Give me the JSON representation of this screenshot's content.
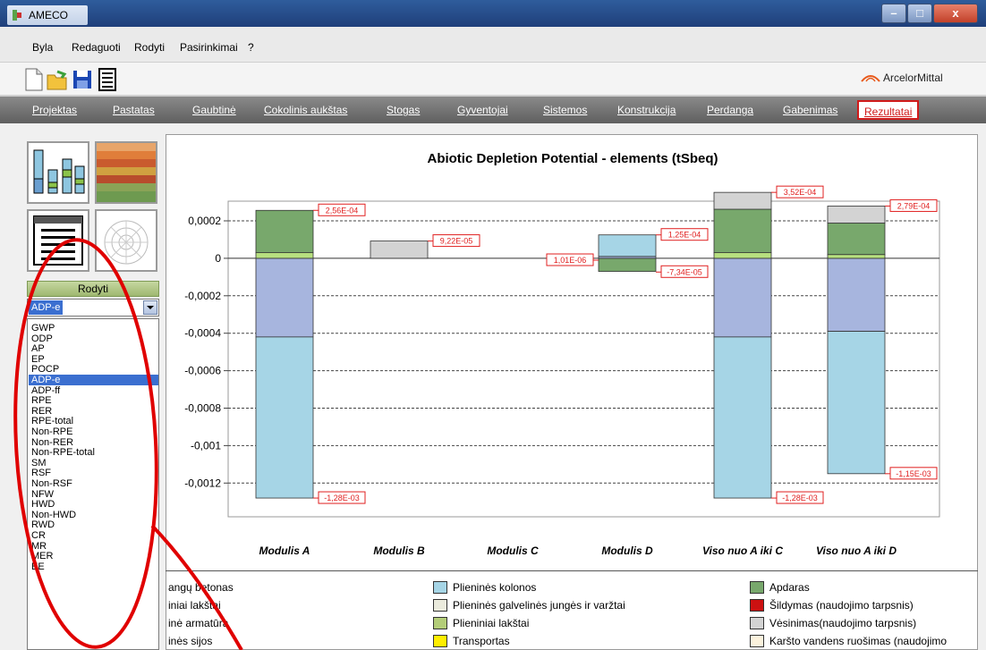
{
  "window": {
    "title": "AMECO",
    "min": "–",
    "max": "□",
    "close": "x"
  },
  "menu": [
    "Byla",
    "Redaguoti",
    "Rodyti",
    "Pasirinkimai",
    "?"
  ],
  "brand": "ArcelorMittal",
  "tabs": [
    {
      "label": "Projektas",
      "active": false
    },
    {
      "label": "Pastatas",
      "active": false
    },
    {
      "label": "Gaubtinė",
      "active": false
    },
    {
      "label": "Cokolinis aukštas",
      "active": false
    },
    {
      "label": "Stogas",
      "active": false
    },
    {
      "label": "Gyventojai",
      "active": false
    },
    {
      "label": "Sistemos",
      "active": false
    },
    {
      "label": "Konstrukcija",
      "active": false
    },
    {
      "label": "Perdanga",
      "active": false
    },
    {
      "label": "Gabenimas",
      "active": false
    },
    {
      "label": "Rezultatai",
      "active": true
    }
  ],
  "left_panel": {
    "section_label": "Rodyti",
    "selected": "ADP-e",
    "options": [
      "GWP",
      "ODP",
      "AP",
      "EP",
      "POCP",
      "ADP-e",
      "ADP-ff",
      "RPE",
      "RER",
      "RPE-total",
      "Non-RPE",
      "Non-RER",
      "Non-RPE-total",
      "SM",
      "RSF",
      "Non-RSF",
      "NFW",
      "HWD",
      "Non-HWD",
      "RWD",
      "CR",
      "MR",
      "MER",
      "EE"
    ]
  },
  "chart_data": {
    "type": "bar",
    "stacked": true,
    "title": "Abiotic Depletion Potential - elements (tSbeq)",
    "categories": [
      "Modulis A",
      "Modulis B",
      "Modulis C",
      "Modulis D",
      "Viso nuo A iki C",
      "Viso nuo A iki D"
    ],
    "ylim": [
      -0.0014,
      0.0004
    ],
    "yticks": [
      "0,0002",
      "0",
      "-0,0002",
      "-0,0004",
      "-0,0006",
      "-0,0008",
      "-0,001",
      "-0,0012"
    ],
    "ytick_values": [
      0.0002,
      0,
      -0.0002,
      -0.0004,
      -0.0006,
      -0.0008,
      -0.001,
      -0.0012
    ],
    "grid": "dashed-horizontal",
    "segments": [
      {
        "cat": 0,
        "from": 0,
        "to": -0.00042,
        "color": "#a7b5de"
      },
      {
        "cat": 0,
        "from": -0.00042,
        "to": -0.00128,
        "color": "#a6d5e6"
      },
      {
        "cat": 0,
        "from": 0,
        "to": 3e-05,
        "color": "#b7e07f"
      },
      {
        "cat": 0,
        "from": 3e-05,
        "to": 0.000256,
        "color": "#78a86c"
      },
      {
        "cat": 1,
        "from": 0,
        "to": 9.22e-05,
        "color": "#d3d3d3"
      },
      {
        "cat": 3,
        "from": 0,
        "to": -7e-05,
        "color": "#78a86c"
      },
      {
        "cat": 3,
        "from": 0,
        "to": 1e-05,
        "color": "#a7b5de"
      },
      {
        "cat": 3,
        "from": 1e-05,
        "to": 0.000125,
        "color": "#a6d5e6"
      },
      {
        "cat": 4,
        "from": 0,
        "to": -0.00042,
        "color": "#a7b5de"
      },
      {
        "cat": 4,
        "from": -0.00042,
        "to": -0.00128,
        "color": "#a6d5e6"
      },
      {
        "cat": 4,
        "from": 0,
        "to": 3e-05,
        "color": "#b7e07f"
      },
      {
        "cat": 4,
        "from": 3e-05,
        "to": 0.000262,
        "color": "#78a86c"
      },
      {
        "cat": 4,
        "from": 0.000262,
        "to": 0.000352,
        "color": "#d3d3d3"
      },
      {
        "cat": 5,
        "from": 0,
        "to": -0.00039,
        "color": "#a7b5de"
      },
      {
        "cat": 5,
        "from": -0.00039,
        "to": -0.00115,
        "color": "#a6d5e6"
      },
      {
        "cat": 5,
        "from": 0,
        "to": 2e-05,
        "color": "#b7e07f"
      },
      {
        "cat": 5,
        "from": 2e-05,
        "to": 0.000188,
        "color": "#78a86c"
      },
      {
        "cat": 5,
        "from": 0.000188,
        "to": 0.000279,
        "color": "#d3d3d3"
      }
    ],
    "labels": [
      {
        "cat": 0,
        "value": 0.000256,
        "text": "2,56E-04",
        "side": "right"
      },
      {
        "cat": 0,
        "value": -0.00128,
        "text": "-1,28E-03",
        "side": "right"
      },
      {
        "cat": 1,
        "value": 9.22e-05,
        "text": "9,22E-05",
        "side": "right"
      },
      {
        "cat": 3,
        "value": 0.000125,
        "text": "1,25E-04",
        "side": "right"
      },
      {
        "cat": 3,
        "value": -7.34e-05,
        "text": "-7,34E-05",
        "side": "right"
      },
      {
        "cat": 3,
        "value": -1.01e-05,
        "text": "1,01E-06",
        "side": "left"
      },
      {
        "cat": 4,
        "value": 0.000352,
        "text": "3,52E-04",
        "side": "right"
      },
      {
        "cat": 4,
        "value": -0.00128,
        "text": "-1,28E-03",
        "side": "right"
      },
      {
        "cat": 5,
        "value": 0.000279,
        "text": "2,79E-04",
        "side": "right"
      },
      {
        "cat": 5,
        "value": -0.00115,
        "text": "-1,15E-03",
        "side": "right"
      }
    ]
  },
  "legend": [
    {
      "label": "angų betonas",
      "color": ""
    },
    {
      "label": "iniai lakštai",
      "color": ""
    },
    {
      "label": "inė armatūra",
      "color": ""
    },
    {
      "label": "inės sijos",
      "color": ""
    },
    {
      "label": "Plieninės kolonos",
      "color": "#a6d5e6"
    },
    {
      "label": "Plieninės galvelinės jungės ir varžtai",
      "color": "#ebebdd"
    },
    {
      "label": "Plieniniai lakštai",
      "color": "#b3cd78"
    },
    {
      "label": "Transportas",
      "color": "#ffee00"
    },
    {
      "label": "Apdaras",
      "color": "#78a86c"
    },
    {
      "label": "Šildymas (naudojimo tarpsnis)",
      "color": "#cc1111"
    },
    {
      "label": "Vėsinimas(naudojimo tarpsnis)",
      "color": "#d3d3d3"
    },
    {
      "label": "Karšto vandens ruošimas (naudojimo",
      "color": "#fbf2dd"
    }
  ]
}
